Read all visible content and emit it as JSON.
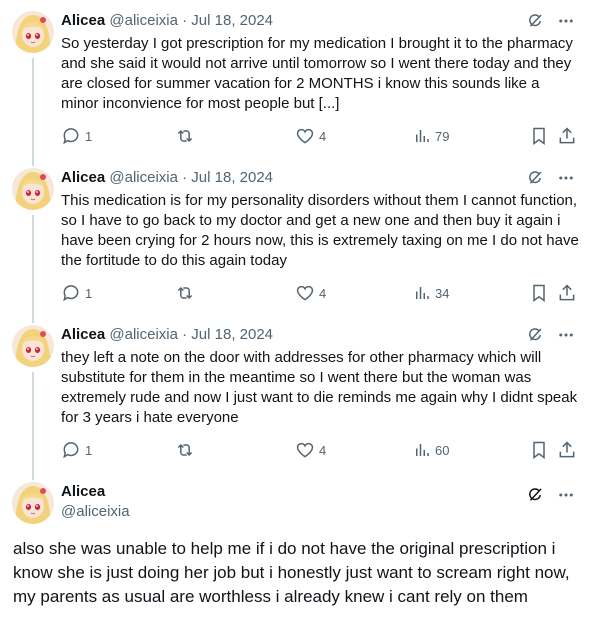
{
  "colors": {
    "text": "#0f1419",
    "muted": "#536471",
    "thread_line": "#cfd9de"
  },
  "tweets": [
    {
      "author": "Alicea",
      "meta": "@aliceixia · Jul 18, 2024",
      "text": "So yesterday I got prescription for my medication I brought it to the pharmacy and she said it would not arrive until tomorrow so I went there today and they are closed for summer vacation for 2 MONTHS i know this sounds like a minor inconvience for most people but [...]",
      "replies": "1",
      "reposts": "",
      "likes": "4",
      "views": "79"
    },
    {
      "author": "Alicea",
      "meta": "@aliceixia · Jul 18, 2024",
      "text": "This medication is for my personality disorders without them I cannot function, so I have to go back to my doctor and get a new one and then buy it again i have been crying for 2 hours now, this is extremely taxing on me I do not have the fortitude to do this again today",
      "replies": "1",
      "reposts": "",
      "likes": "4",
      "views": "34"
    },
    {
      "author": "Alicea",
      "meta": "@aliceixia · Jul 18, 2024",
      "text": "they left a note on the door with addresses for other pharmacy which will substitute for them in the meantime so I went there but the woman was extremely rude and now I just want to die reminds me again why I didnt speak for 3 years i hate everyone",
      "replies": "1",
      "reposts": "",
      "likes": "4",
      "views": "60"
    }
  ],
  "focused": {
    "author": "Alicea",
    "handle": "@aliceixia",
    "text": "also she was unable to help me if i do not have the original prescription i know she is just doing her job but i honestly just want to scream right now, my parents as usual are worthless i already knew i cant rely on them"
  },
  "icons": [
    "grok-icon",
    "more-icon",
    "reply-icon",
    "repost-icon",
    "like-icon",
    "views-icon",
    "bookmark-icon",
    "share-icon"
  ]
}
